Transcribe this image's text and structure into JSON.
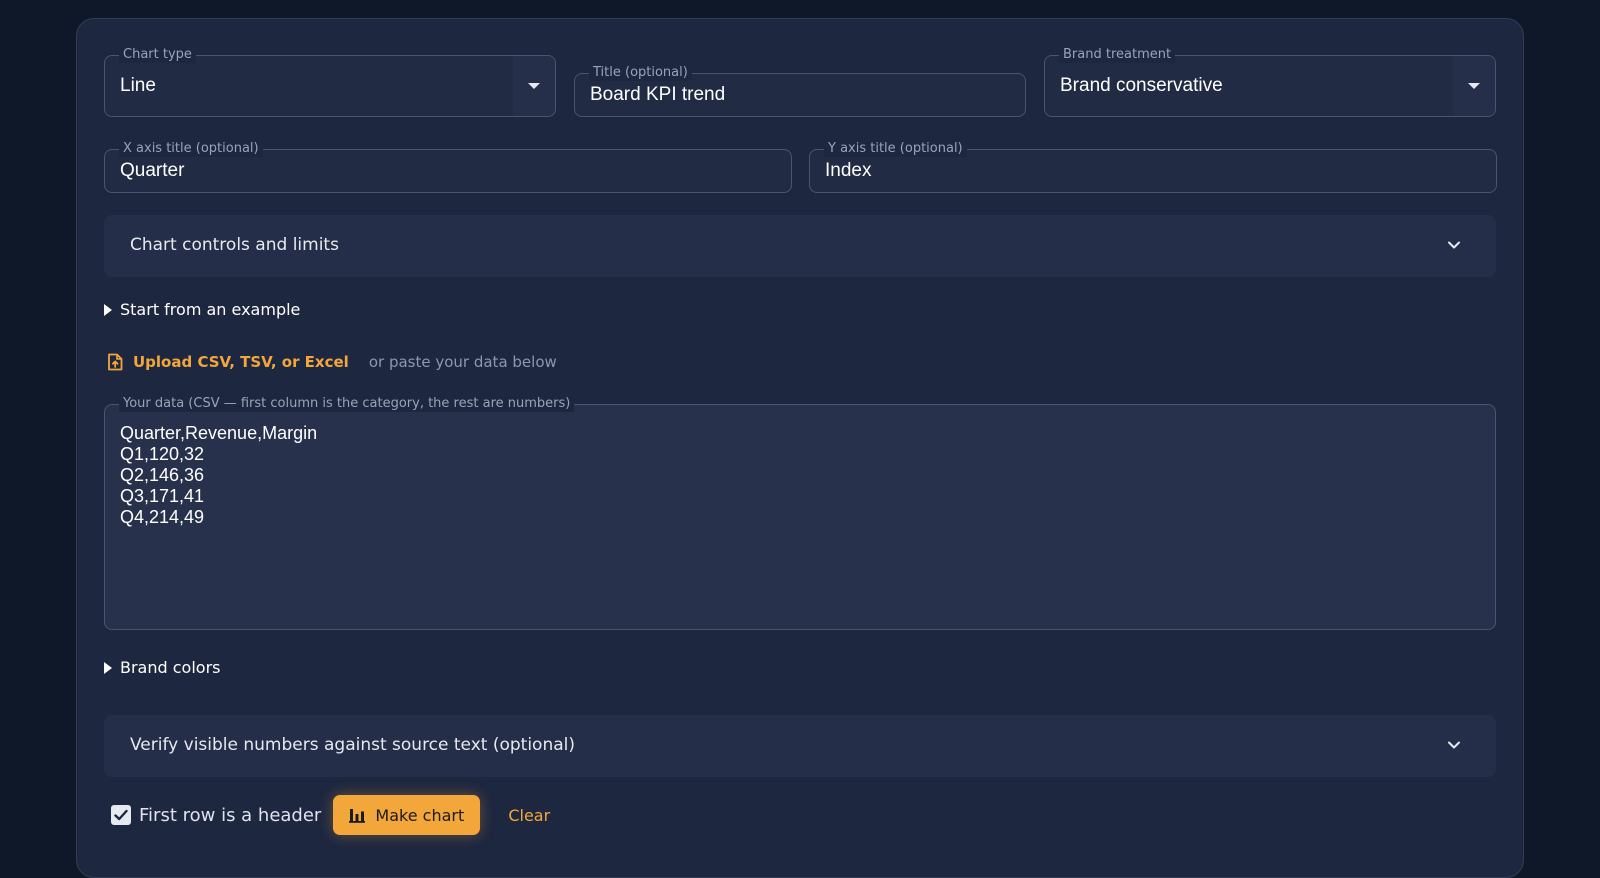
{
  "chart_type": {
    "label": "Chart type",
    "value": "Line"
  },
  "title_field": {
    "label": "Title (optional)",
    "value": "Board KPI trend"
  },
  "brand_treatment": {
    "label": "Brand treatment",
    "value": "Brand conservative"
  },
  "x_axis": {
    "label": "X axis title (optional)",
    "value": "Quarter"
  },
  "y_axis": {
    "label": "Y axis title (optional)",
    "value": "Index"
  },
  "controls_accordion": {
    "label": "Chart controls and limits",
    "icon": "chevron-down-icon"
  },
  "example_disclosure": {
    "label": "Start from an example"
  },
  "upload": {
    "link": "Upload CSV, TSV, or Excel",
    "hint": "or paste your data below",
    "icon": "file-upload-icon"
  },
  "data_field": {
    "label": "Your data (CSV — first column is the category, the rest are numbers)",
    "value": "Quarter,Revenue,Margin\nQ1,120,32\nQ2,146,36\nQ3,171,41\nQ4,214,49"
  },
  "brand_colors_disclosure": {
    "label": "Brand colors"
  },
  "verify_accordion": {
    "label": "Verify visible numbers against source text (optional)",
    "icon": "chevron-down-icon"
  },
  "header_checkbox": {
    "label": "First row is a header",
    "checked": true
  },
  "make_chart_button": {
    "label": "Make chart",
    "icon": "bar-chart-icon"
  },
  "clear_button": {
    "label": "Clear"
  },
  "colors": {
    "accent": "#f3a73b",
    "background": "#0f1829",
    "card": "#1e2740"
  }
}
